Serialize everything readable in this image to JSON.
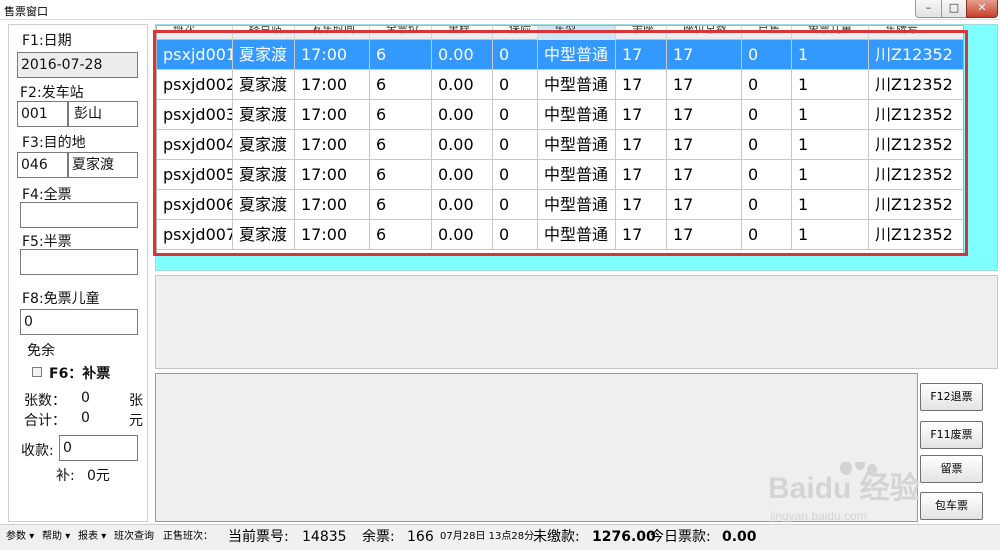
{
  "window": {
    "title": "售票窗口",
    "minimize": "–",
    "maximize": "□",
    "close": "✕"
  },
  "left": {
    "f1_label": "F1:日期",
    "date": "2016-07-28",
    "f2_label": "F2:发车站",
    "from_code": "001",
    "from_name": "彭山",
    "f3_label": "F3:目的地",
    "to_code": "046",
    "to_name": "夏家渡",
    "f4_label": "F4:全票",
    "f4_value": "",
    "f5_label": "F5:半票",
    "f5_value": "",
    "f8_label": "F8:免票儿童",
    "f8_value": "0",
    "mianyu": "免余",
    "f6_label": "F6：补票",
    "zhangshu_label": "张数：",
    "zhangshu_value": "0",
    "zhang_unit": "张",
    "heji_label": "合计：",
    "heji_value": "0",
    "yuan_unit": "元",
    "shoukuan_label": "收款:",
    "shoukuan_value": "0",
    "bu_label": "补:",
    "bu_value": "0元"
  },
  "table": {
    "columns": [
      "班次",
      "终点站",
      "发车时间",
      "全票价",
      "里程",
      "保险",
      "车型",
      "余座",
      "座位总数",
      "已售",
      "免票儿童",
      "车牌号"
    ],
    "rows": [
      [
        "psxjd001",
        "夏家渡",
        "17:00",
        "6",
        "0.00",
        "0",
        "中型普通",
        "17",
        "17",
        "0",
        "1",
        "川Z12352"
      ],
      [
        "psxjd002",
        "夏家渡",
        "17:00",
        "6",
        "0.00",
        "0",
        "中型普通",
        "17",
        "17",
        "0",
        "1",
        "川Z12352"
      ],
      [
        "psxjd003",
        "夏家渡",
        "17:00",
        "6",
        "0.00",
        "0",
        "中型普通",
        "17",
        "17",
        "0",
        "1",
        "川Z12352"
      ],
      [
        "psxjd004",
        "夏家渡",
        "17:00",
        "6",
        "0.00",
        "0",
        "中型普通",
        "17",
        "17",
        "0",
        "1",
        "川Z12352"
      ],
      [
        "psxjd005",
        "夏家渡",
        "17:00",
        "6",
        "0.00",
        "0",
        "中型普通",
        "17",
        "17",
        "0",
        "1",
        "川Z12352"
      ],
      [
        "psxjd006",
        "夏家渡",
        "17:00",
        "6",
        "0.00",
        "0",
        "中型普通",
        "17",
        "17",
        "0",
        "1",
        "川Z12352"
      ],
      [
        "psxjd007",
        "夏家渡",
        "17:00",
        "6",
        "0.00",
        "0",
        "中型普通",
        "17",
        "17",
        "0",
        "1",
        "川Z12352"
      ]
    ],
    "selected_row": 0
  },
  "buttons": {
    "refund": "F12退票",
    "void": "F11废票",
    "reserve": "留票",
    "charter": "包车票"
  },
  "status": {
    "menu_params": "参数",
    "menu_help": "帮助",
    "menu_report": "报表",
    "menu_query": "班次查询",
    "selling_label": "正售班次：",
    "ticket_no_label": "当前票号:",
    "ticket_no": "14835",
    "remaining_label": "余票:",
    "remaining": "166",
    "datetime": "07月28日 13点28分",
    "unpaid_label": "未缴款:",
    "unpaid": "1276.00",
    "today_label": "今日票款:",
    "today": "0.00"
  },
  "watermark": {
    "brand": "Baidu 经验",
    "url": "jingyan.baidu.com"
  },
  "colors": {
    "selection": "#3399ff",
    "panel_cyan": "#80ffff",
    "highlight_frame": "#d9343a"
  }
}
